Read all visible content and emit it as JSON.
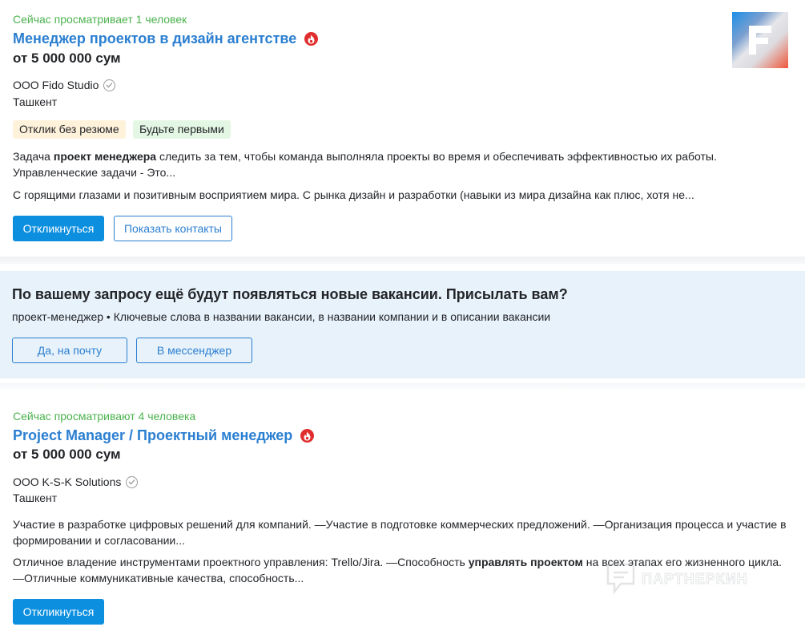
{
  "vacancy1": {
    "viewers": "Сейчас просматривает 1 человек",
    "title": "Менеджер проектов в дизайн агентстве",
    "salary": "от 5 000 000 сум",
    "company": "ООО Fido Studio",
    "city": "Ташкент",
    "tags": [
      "Отклик без резюме",
      "Будьте первыми"
    ],
    "desc1_pre": "Задача ",
    "desc1_bold": "проект менеджера",
    "desc1_post": " следить за тем, чтобы команда выполняла проекты во время и обеспечивать эффективностью их работы. Управленческие задачи - Это...",
    "desc2": "С горящими глазами и позитивным восприятием мира. С рынка дизайн и разработки (навыки из мира дизайна как плюс, хотя не...",
    "respond_label": "Откликнуться",
    "contacts_label": "Показать контакты",
    "logo_letter": "F"
  },
  "subscribe": {
    "title": "По вашему запросу ещё будут появляться новые вакансии. Присылать вам?",
    "subtitle": "проект-менеджер • Ключевые слова в названии вакансии, в названии компании и в описании вакансии",
    "email_label": "Да, на почту",
    "messenger_label": "В мессенджер"
  },
  "vacancy2": {
    "viewers": "Сейчас просматривают 4 человека",
    "title": "Project Manager / Проектный менеджер",
    "salary": "от 5 000 000 сум",
    "company": "ООО K-S-K Solutions",
    "city": "Ташкент",
    "desc1": "Участие в разработке цифровых решений для компаний. —Участие в подготовке коммерческих предложений. —Организация процесса и участие в формировании и согласовании...",
    "desc2_pre": "Отличное владение инструментами проектного управления: Trello/Jira. —Способность ",
    "desc2_bold": "управлять проектом",
    "desc2_post": " на всех этапах его жизненного цикла. —Отличные коммуникативные качества, способность...",
    "respond_label": "Откликнуться"
  },
  "watermark": {
    "text": "ПАРТНЕРКИН"
  },
  "colors": {
    "link": "#2b7fd1",
    "viewers_green": "#4bb24e",
    "primary_button": "#0d8fe0",
    "hot_badge": "#e02e2e",
    "banner_bg": "#e8f2fa",
    "tag_orange_bg": "#fff2db",
    "tag_green_bg": "#e4f7e4"
  },
  "icons": [
    "fire-icon",
    "verified-check-icon",
    "company-logo",
    "partnerkin-watermark-icon"
  ]
}
